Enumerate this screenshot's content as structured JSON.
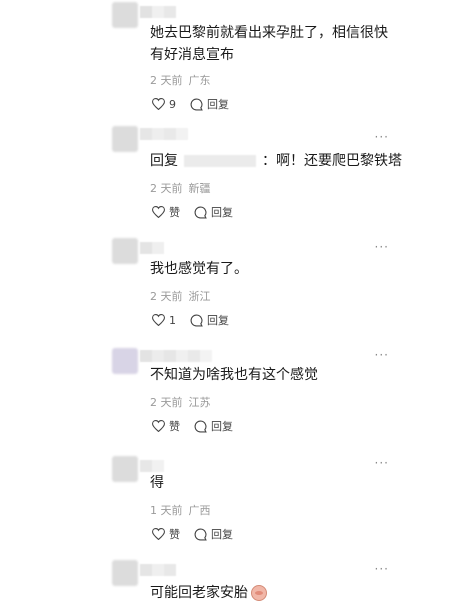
{
  "comments": [
    {
      "text": "她去巴黎前就看出来孕肚了，相信很快有好消息宣布",
      "time": "2 天前",
      "region": "广东",
      "likes": "9",
      "reply": "回复"
    },
    {
      "text_prefix": "回复",
      "text_body": "：啊！还要爬巴黎铁塔",
      "time": "2 天前",
      "region": "新疆",
      "likes": "赞",
      "reply": "回复"
    },
    {
      "text": "我也感觉有了。",
      "time": "2 天前",
      "region": "浙江",
      "likes": "1",
      "reply": "回复"
    },
    {
      "text": "不知道为啥我也有这个感觉",
      "time": "2 天前",
      "region": "江苏",
      "likes": "赞",
      "reply": "回复"
    },
    {
      "text": "得",
      "time": "1 天前",
      "region": "广西",
      "likes": "赞",
      "reply": "回复"
    },
    {
      "text": "可能回老家安胎",
      "emoji": "pig-face-emoji"
    }
  ],
  "more_label": "···",
  "colors": {
    "text": "#1a1a1a",
    "meta": "#9a9a9a",
    "avatar": "#dcdcdc"
  }
}
